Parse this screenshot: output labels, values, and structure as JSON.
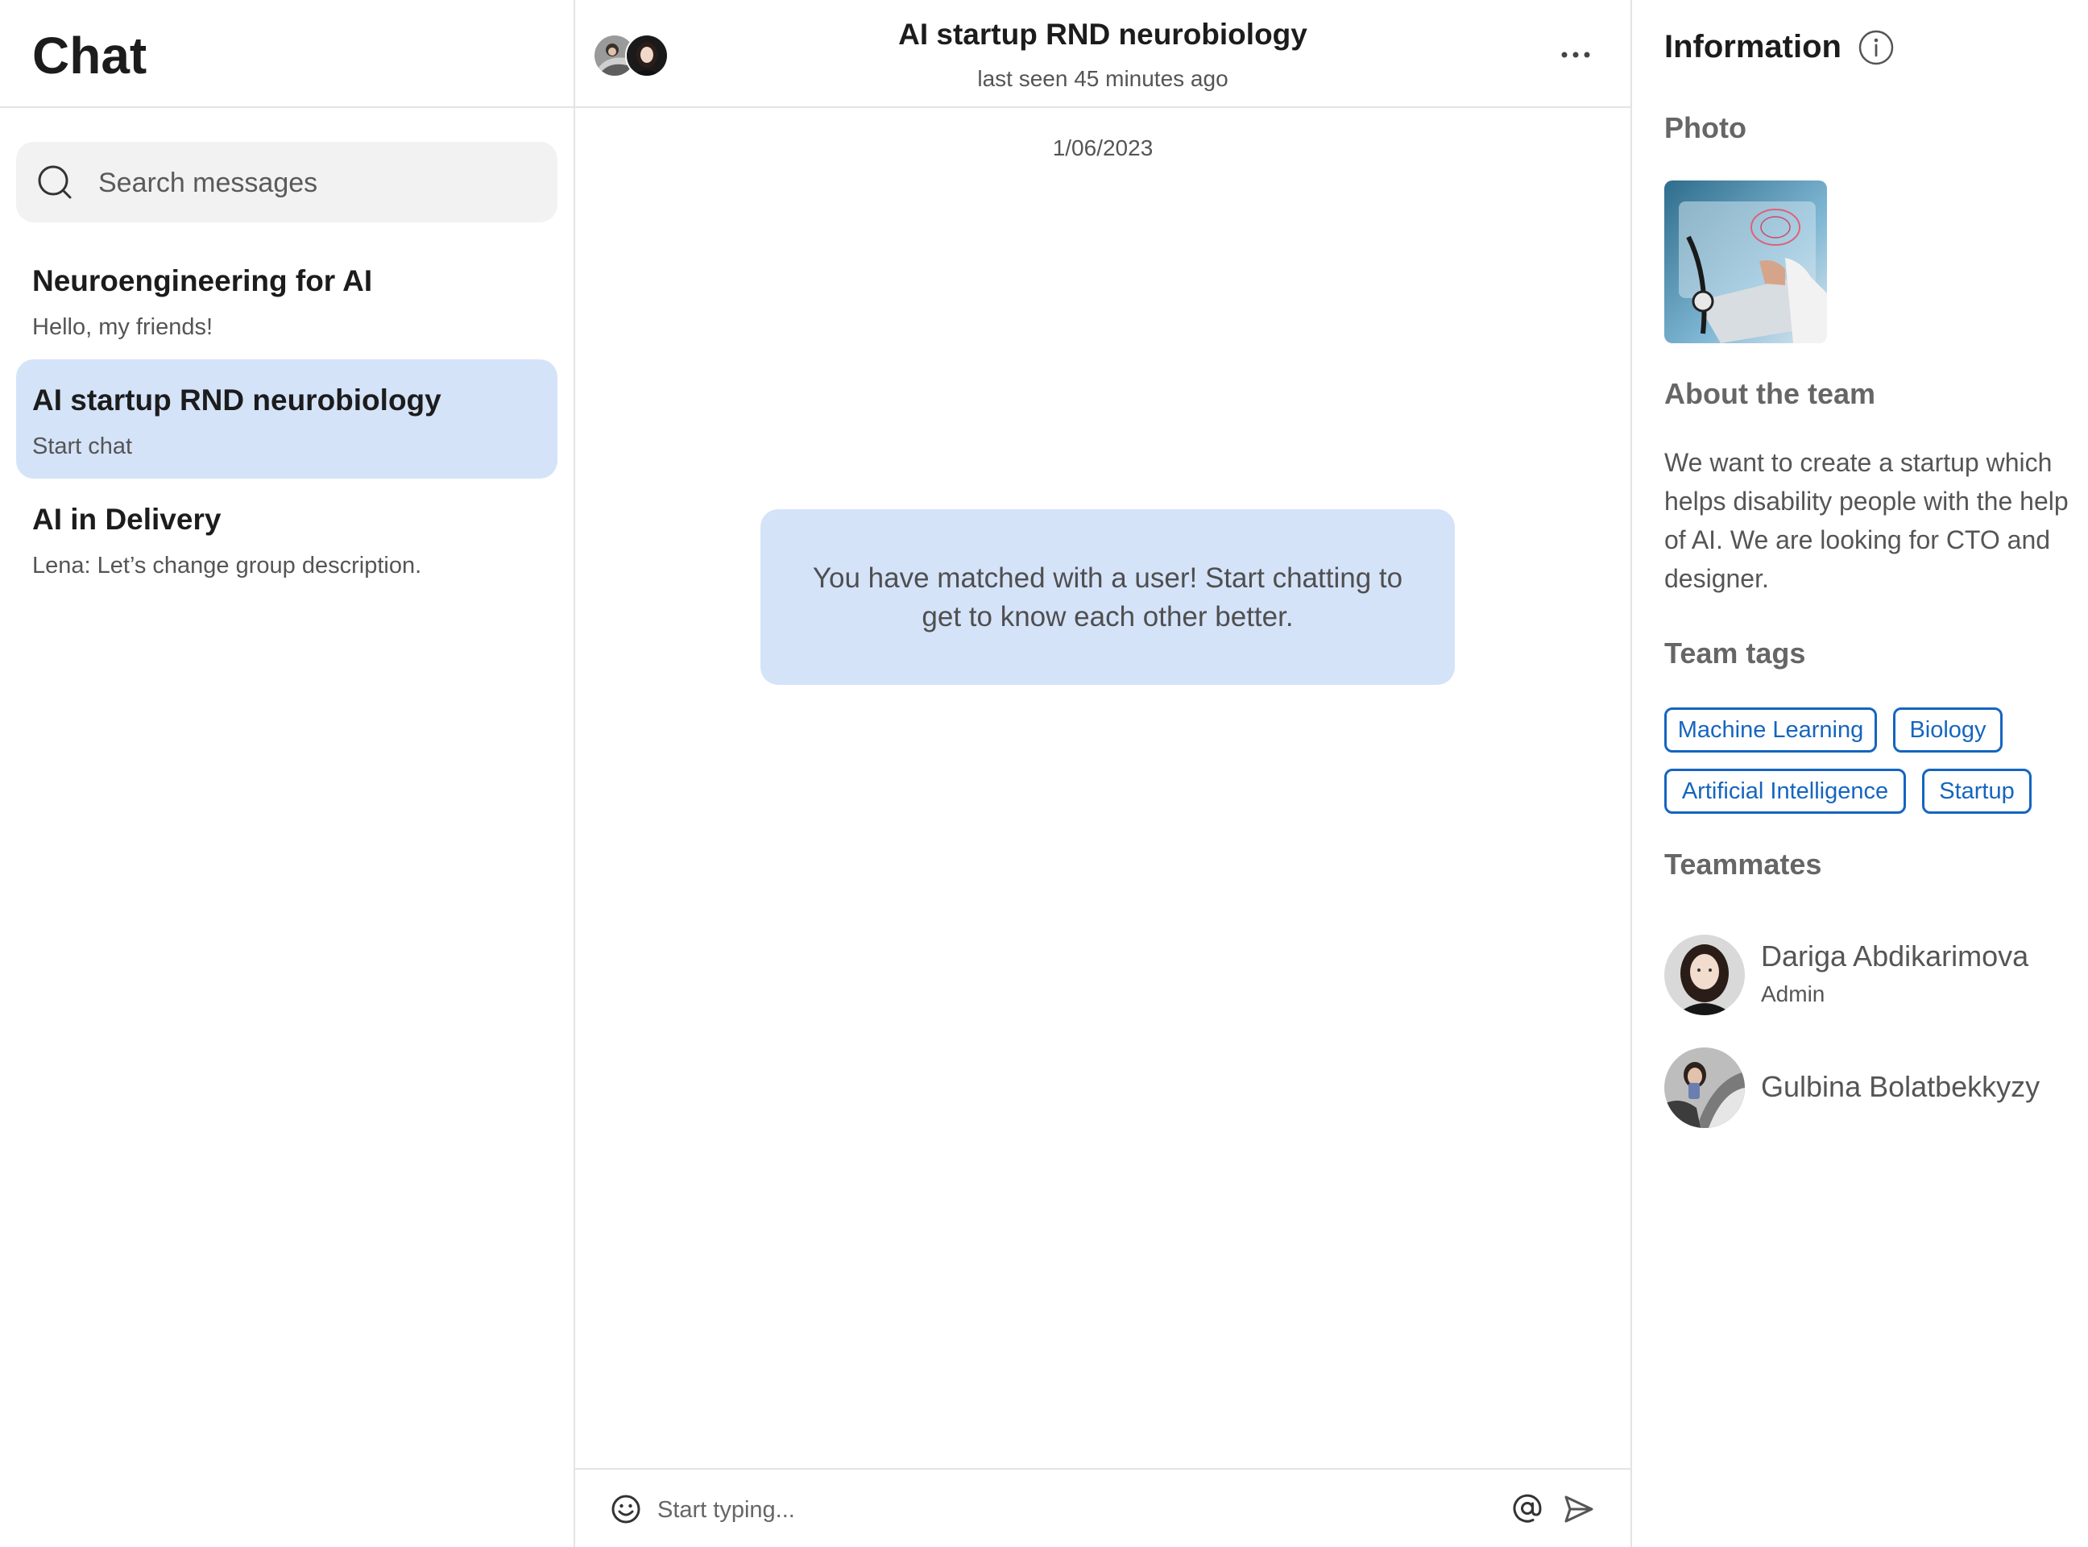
{
  "sidebar": {
    "title": "Chat",
    "search_placeholder": "Search messages",
    "chats": [
      {
        "name": "Neuroengineering for AI",
        "preview": "Hello, my friends!"
      },
      {
        "name": "AI startup RND neurobiology",
        "preview": "Start chat"
      },
      {
        "name": "AI in Delivery",
        "preview": "Lena: Let’s change group description."
      }
    ],
    "active_index": 1
  },
  "conversation": {
    "title": "AI startup RND neurobiology",
    "status": "last seen 45 minutes ago",
    "date": "1/06/2023",
    "system_message": "You have matched with a user! Start chatting to get to know each other better.",
    "composer_placeholder": "Start typing..."
  },
  "info": {
    "title": "Information",
    "photo_label": "Photo",
    "about_label": "About the team",
    "about_text": "We want to create a startup which helps disability people with the help of AI. We are looking for CTO and designer.",
    "tags_label": "Team tags",
    "tags": [
      "Machine Learning",
      "Biology",
      "Artificial Intelligence",
      "Startup"
    ],
    "teammates_label": "Teammates",
    "teammates": [
      {
        "name": "Dariga Abdikarimova",
        "role": "Admin"
      },
      {
        "name": "Gulbina Bolatbekkyzy",
        "role": ""
      }
    ]
  },
  "colors": {
    "active_chat_bg": "#d5e3f9",
    "tag_accent": "#1565c0",
    "divider": "#e3e3e3",
    "search_bg": "#f2f2f2"
  },
  "icons": [
    "search-icon",
    "more-icon",
    "emoji-icon",
    "at-icon",
    "send-icon",
    "info-icon"
  ]
}
